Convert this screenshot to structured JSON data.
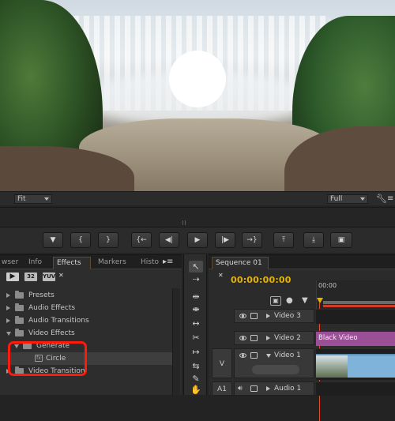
{
  "monitor": {
    "zoom_value": "Fit",
    "quality_value": "Full"
  },
  "transport": {
    "buttons": [
      {
        "icon": "add-marker-icon",
        "glyph": "▼"
      },
      {
        "icon": "mark-in-icon",
        "glyph": "{"
      },
      {
        "icon": "mark-out-icon",
        "glyph": "}"
      },
      {
        "icon": "go-to-in-icon",
        "glyph": "{←"
      },
      {
        "icon": "step-back-icon",
        "glyph": "◀|"
      },
      {
        "icon": "play-icon",
        "glyph": "▶"
      },
      {
        "icon": "step-forward-icon",
        "glyph": "|▶"
      },
      {
        "icon": "go-to-out-icon",
        "glyph": "→}"
      },
      {
        "icon": "lift-icon",
        "glyph": "⤒"
      },
      {
        "icon": "extract-icon",
        "glyph": "⤓"
      },
      {
        "icon": "export-frame-icon",
        "glyph": "▣"
      }
    ]
  },
  "effects_panel": {
    "tabs": [
      "wser",
      "Info",
      "Effects",
      "Markers",
      "Histo"
    ],
    "active_tab": "Effects",
    "bin_badges": [
      "32",
      "YUV"
    ],
    "tree": [
      {
        "label": "Presets",
        "level": 0,
        "expanded": false
      },
      {
        "label": "Audio Effects",
        "level": 0,
        "expanded": false
      },
      {
        "label": "Audio Transitions",
        "level": 0,
        "expanded": false
      },
      {
        "label": "Video Effects",
        "level": 0,
        "expanded": true
      },
      {
        "label": "Generate",
        "level": 1,
        "expanded": true
      },
      {
        "label": "Circle",
        "level": 2,
        "expanded": false
      },
      {
        "label": "Video Transition",
        "level": 0,
        "expanded": false
      }
    ],
    "highlight_color": "#ff1a0a"
  },
  "timeline": {
    "tab_label": "Sequence 01",
    "timecode": "00:00:00:00",
    "ruler_time": "00:00",
    "tracks": [
      {
        "label": "Video 3",
        "type": "video"
      },
      {
        "label": "Video 2",
        "type": "video",
        "clip": "Black Video",
        "clip_color": "#9b4f96"
      },
      {
        "label": "Video 1",
        "type": "video",
        "side_label": "V"
      },
      {
        "label": "Audio 1",
        "type": "audio",
        "side_label": "A1"
      }
    ],
    "timecode_color": "#e8b300"
  }
}
